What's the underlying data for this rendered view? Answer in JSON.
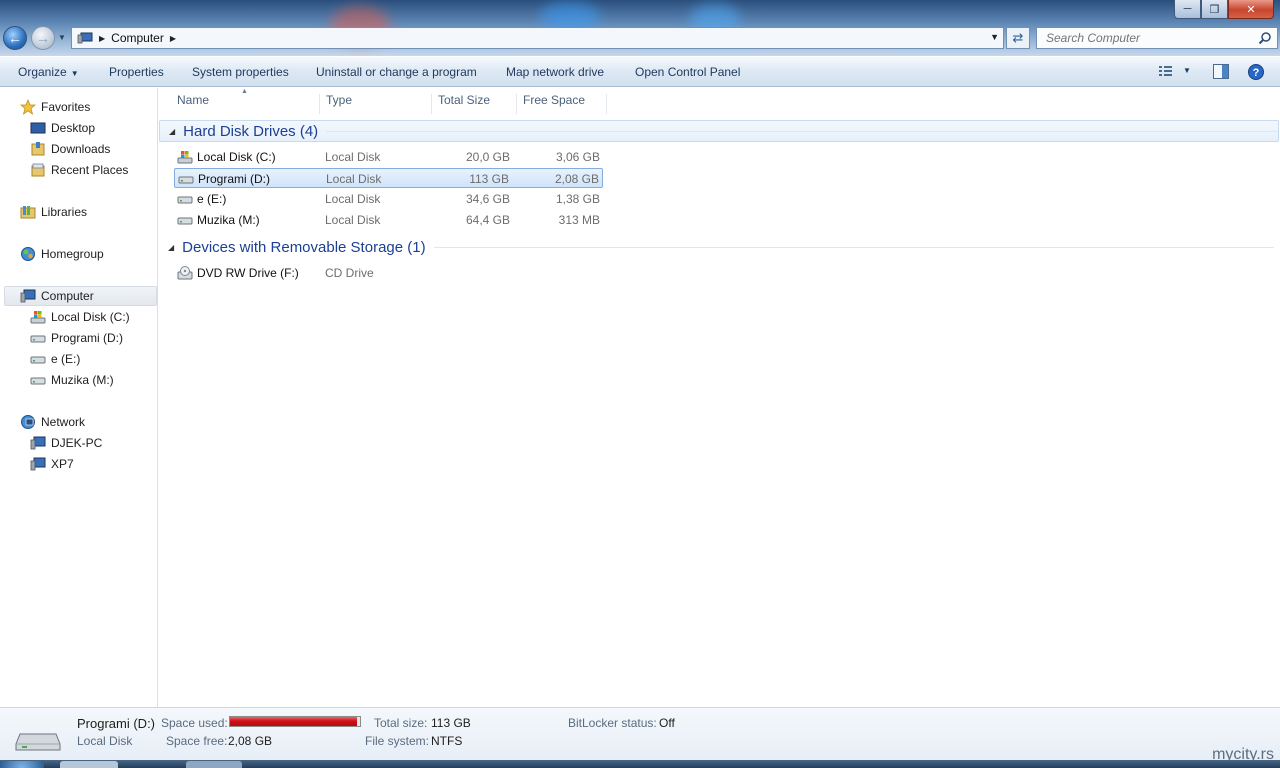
{
  "titlebar": {
    "minimize_icon": "minimize-icon",
    "maximize_icon": "restore-icon",
    "close_icon": "close-icon"
  },
  "address": {
    "crumbs": [
      "Computer"
    ],
    "search_placeholder": "Search Computer"
  },
  "toolbar": {
    "organize": "Organize",
    "properties": "Properties",
    "system_properties": "System properties",
    "uninstall": "Uninstall or change a program",
    "map_drive": "Map network drive",
    "control_panel": "Open Control Panel"
  },
  "nav": {
    "favorites": "Favorites",
    "desktop": "Desktop",
    "downloads": "Downloads",
    "recent": "Recent Places",
    "libraries": "Libraries",
    "homegroup": "Homegroup",
    "computer": "Computer",
    "computer_drives": [
      "Local Disk (C:)",
      "Programi (D:)",
      "e (E:)",
      "Muzika (M:)"
    ],
    "network": "Network",
    "network_items": [
      "DJEK-PC",
      "XP7"
    ]
  },
  "columns": {
    "name": "Name",
    "type": "Type",
    "total": "Total Size",
    "free": "Free Space"
  },
  "groups": {
    "hdd": "Hard Disk Drives (4)",
    "removable": "Devices with Removable Storage (1)"
  },
  "drives": [
    {
      "name": "Local Disk (C:)",
      "type": "Local Disk",
      "total": "20,0 GB",
      "free": "3,06 GB"
    },
    {
      "name": "Programi (D:)",
      "type": "Local Disk",
      "total": "113 GB",
      "free": "2,08 GB"
    },
    {
      "name": "e (E:)",
      "type": "Local Disk",
      "total": "34,6 GB",
      "free": "1,38 GB"
    },
    {
      "name": "Muzika (M:)",
      "type": "Local Disk",
      "total": "64,4 GB",
      "free": "313 MB"
    }
  ],
  "removable": [
    {
      "name": "DVD RW Drive (F:)",
      "type": "CD Drive"
    }
  ],
  "details": {
    "name": "Programi (D:)",
    "type": "Local Disk",
    "space_used_label": "Space used:",
    "space_free_label": "Space free:",
    "space_free": "2,08 GB",
    "total_label": "Total size:",
    "total": "113 GB",
    "fs_label": "File system:",
    "fs": "NTFS",
    "bitlocker_label": "BitLocker status:",
    "bitlocker": "Off",
    "used_fraction": 0.98
  },
  "watermark": "mycity.rs",
  "colors": {
    "accent": "#1c3f94",
    "usage_bar": "#d00f16",
    "selection": "#cfe4fb"
  }
}
